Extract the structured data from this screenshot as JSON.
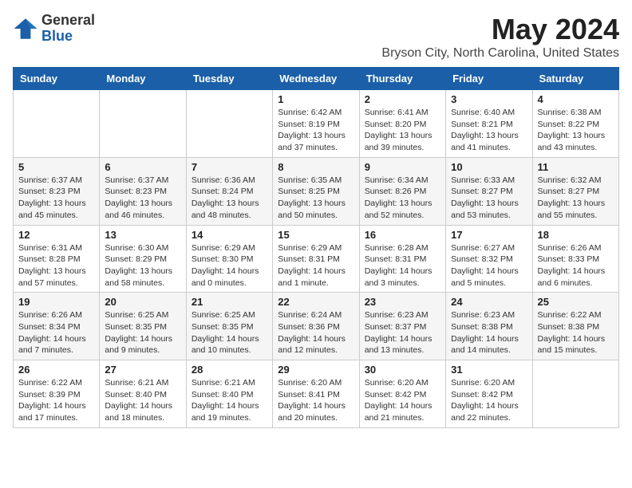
{
  "header": {
    "logo_general": "General",
    "logo_blue": "Blue",
    "month_year": "May 2024",
    "location": "Bryson City, North Carolina, United States"
  },
  "weekdays": [
    "Sunday",
    "Monday",
    "Tuesday",
    "Wednesday",
    "Thursday",
    "Friday",
    "Saturday"
  ],
  "weeks": [
    [
      {
        "day": "",
        "sunrise": "",
        "sunset": "",
        "daylight": ""
      },
      {
        "day": "",
        "sunrise": "",
        "sunset": "",
        "daylight": ""
      },
      {
        "day": "",
        "sunrise": "",
        "sunset": "",
        "daylight": ""
      },
      {
        "day": "1",
        "sunrise": "Sunrise: 6:42 AM",
        "sunset": "Sunset: 8:19 PM",
        "daylight": "Daylight: 13 hours and 37 minutes."
      },
      {
        "day": "2",
        "sunrise": "Sunrise: 6:41 AM",
        "sunset": "Sunset: 8:20 PM",
        "daylight": "Daylight: 13 hours and 39 minutes."
      },
      {
        "day": "3",
        "sunrise": "Sunrise: 6:40 AM",
        "sunset": "Sunset: 8:21 PM",
        "daylight": "Daylight: 13 hours and 41 minutes."
      },
      {
        "day": "4",
        "sunrise": "Sunrise: 6:38 AM",
        "sunset": "Sunset: 8:22 PM",
        "daylight": "Daylight: 13 hours and 43 minutes."
      }
    ],
    [
      {
        "day": "5",
        "sunrise": "Sunrise: 6:37 AM",
        "sunset": "Sunset: 8:23 PM",
        "daylight": "Daylight: 13 hours and 45 minutes."
      },
      {
        "day": "6",
        "sunrise": "Sunrise: 6:37 AM",
        "sunset": "Sunset: 8:23 PM",
        "daylight": "Daylight: 13 hours and 46 minutes."
      },
      {
        "day": "7",
        "sunrise": "Sunrise: 6:36 AM",
        "sunset": "Sunset: 8:24 PM",
        "daylight": "Daylight: 13 hours and 48 minutes."
      },
      {
        "day": "8",
        "sunrise": "Sunrise: 6:35 AM",
        "sunset": "Sunset: 8:25 PM",
        "daylight": "Daylight: 13 hours and 50 minutes."
      },
      {
        "day": "9",
        "sunrise": "Sunrise: 6:34 AM",
        "sunset": "Sunset: 8:26 PM",
        "daylight": "Daylight: 13 hours and 52 minutes."
      },
      {
        "day": "10",
        "sunrise": "Sunrise: 6:33 AM",
        "sunset": "Sunset: 8:27 PM",
        "daylight": "Daylight: 13 hours and 53 minutes."
      },
      {
        "day": "11",
        "sunrise": "Sunrise: 6:32 AM",
        "sunset": "Sunset: 8:27 PM",
        "daylight": "Daylight: 13 hours and 55 minutes."
      }
    ],
    [
      {
        "day": "12",
        "sunrise": "Sunrise: 6:31 AM",
        "sunset": "Sunset: 8:28 PM",
        "daylight": "Daylight: 13 hours and 57 minutes."
      },
      {
        "day": "13",
        "sunrise": "Sunrise: 6:30 AM",
        "sunset": "Sunset: 8:29 PM",
        "daylight": "Daylight: 13 hours and 58 minutes."
      },
      {
        "day": "14",
        "sunrise": "Sunrise: 6:29 AM",
        "sunset": "Sunset: 8:30 PM",
        "daylight": "Daylight: 14 hours and 0 minutes."
      },
      {
        "day": "15",
        "sunrise": "Sunrise: 6:29 AM",
        "sunset": "Sunset: 8:31 PM",
        "daylight": "Daylight: 14 hours and 1 minute."
      },
      {
        "day": "16",
        "sunrise": "Sunrise: 6:28 AM",
        "sunset": "Sunset: 8:31 PM",
        "daylight": "Daylight: 14 hours and 3 minutes."
      },
      {
        "day": "17",
        "sunrise": "Sunrise: 6:27 AM",
        "sunset": "Sunset: 8:32 PM",
        "daylight": "Daylight: 14 hours and 5 minutes."
      },
      {
        "day": "18",
        "sunrise": "Sunrise: 6:26 AM",
        "sunset": "Sunset: 8:33 PM",
        "daylight": "Daylight: 14 hours and 6 minutes."
      }
    ],
    [
      {
        "day": "19",
        "sunrise": "Sunrise: 6:26 AM",
        "sunset": "Sunset: 8:34 PM",
        "daylight": "Daylight: 14 hours and 7 minutes."
      },
      {
        "day": "20",
        "sunrise": "Sunrise: 6:25 AM",
        "sunset": "Sunset: 8:35 PM",
        "daylight": "Daylight: 14 hours and 9 minutes."
      },
      {
        "day": "21",
        "sunrise": "Sunrise: 6:25 AM",
        "sunset": "Sunset: 8:35 PM",
        "daylight": "Daylight: 14 hours and 10 minutes."
      },
      {
        "day": "22",
        "sunrise": "Sunrise: 6:24 AM",
        "sunset": "Sunset: 8:36 PM",
        "daylight": "Daylight: 14 hours and 12 minutes."
      },
      {
        "day": "23",
        "sunrise": "Sunrise: 6:23 AM",
        "sunset": "Sunset: 8:37 PM",
        "daylight": "Daylight: 14 hours and 13 minutes."
      },
      {
        "day": "24",
        "sunrise": "Sunrise: 6:23 AM",
        "sunset": "Sunset: 8:38 PM",
        "daylight": "Daylight: 14 hours and 14 minutes."
      },
      {
        "day": "25",
        "sunrise": "Sunrise: 6:22 AM",
        "sunset": "Sunset: 8:38 PM",
        "daylight": "Daylight: 14 hours and 15 minutes."
      }
    ],
    [
      {
        "day": "26",
        "sunrise": "Sunrise: 6:22 AM",
        "sunset": "Sunset: 8:39 PM",
        "daylight": "Daylight: 14 hours and 17 minutes."
      },
      {
        "day": "27",
        "sunrise": "Sunrise: 6:21 AM",
        "sunset": "Sunset: 8:40 PM",
        "daylight": "Daylight: 14 hours and 18 minutes."
      },
      {
        "day": "28",
        "sunrise": "Sunrise: 6:21 AM",
        "sunset": "Sunset: 8:40 PM",
        "daylight": "Daylight: 14 hours and 19 minutes."
      },
      {
        "day": "29",
        "sunrise": "Sunrise: 6:20 AM",
        "sunset": "Sunset: 8:41 PM",
        "daylight": "Daylight: 14 hours and 20 minutes."
      },
      {
        "day": "30",
        "sunrise": "Sunrise: 6:20 AM",
        "sunset": "Sunset: 8:42 PM",
        "daylight": "Daylight: 14 hours and 21 minutes."
      },
      {
        "day": "31",
        "sunrise": "Sunrise: 6:20 AM",
        "sunset": "Sunset: 8:42 PM",
        "daylight": "Daylight: 14 hours and 22 minutes."
      },
      {
        "day": "",
        "sunrise": "",
        "sunset": "",
        "daylight": ""
      }
    ]
  ]
}
